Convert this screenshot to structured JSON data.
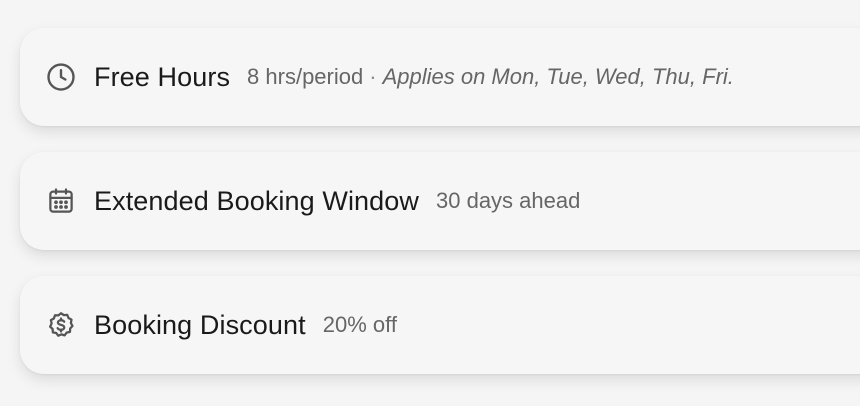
{
  "benefits": [
    {
      "icon": "clock-icon",
      "title": "Free Hours",
      "value": "8 hrs/period",
      "separator": "·",
      "note": "Applies on Mon, Tue, Wed, Thu, Fri."
    },
    {
      "icon": "calendar-icon",
      "title": "Extended Booking Window",
      "value": "30 days ahead"
    },
    {
      "icon": "discount-badge-icon",
      "title": "Booking Discount",
      "value": "20% off"
    }
  ]
}
